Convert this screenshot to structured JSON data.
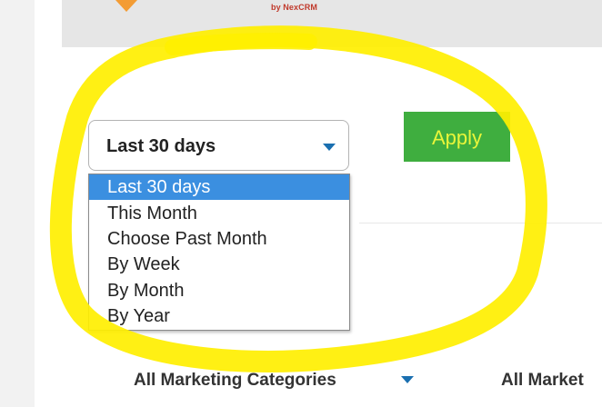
{
  "colors": {
    "accent_blue": "#3b8fe0",
    "caret_blue": "#1a6fb0",
    "apply_green": "#3fae3f",
    "apply_text": "#e9f53a",
    "highlight_yellow": "#ffef00",
    "header_grey": "#e6e6e6"
  },
  "header": {
    "logo_icon": "logo-chevron-icon",
    "logo_subtitle": "by NexCRM"
  },
  "period_select": {
    "value": "Last 30 days",
    "icon": "caret-down-icon",
    "options": [
      "Last 30 days",
      "This Month",
      "Choose Past Month",
      "By Week",
      "By Month",
      "By Year"
    ],
    "selected_index": 0
  },
  "apply_button": {
    "label": "Apply"
  },
  "filters": {
    "marketing_categories": "All Marketing Categories",
    "marketing_partial": "All Market"
  },
  "annotation": {
    "shape": "hand-drawn-circle",
    "color": "#ffef00"
  }
}
